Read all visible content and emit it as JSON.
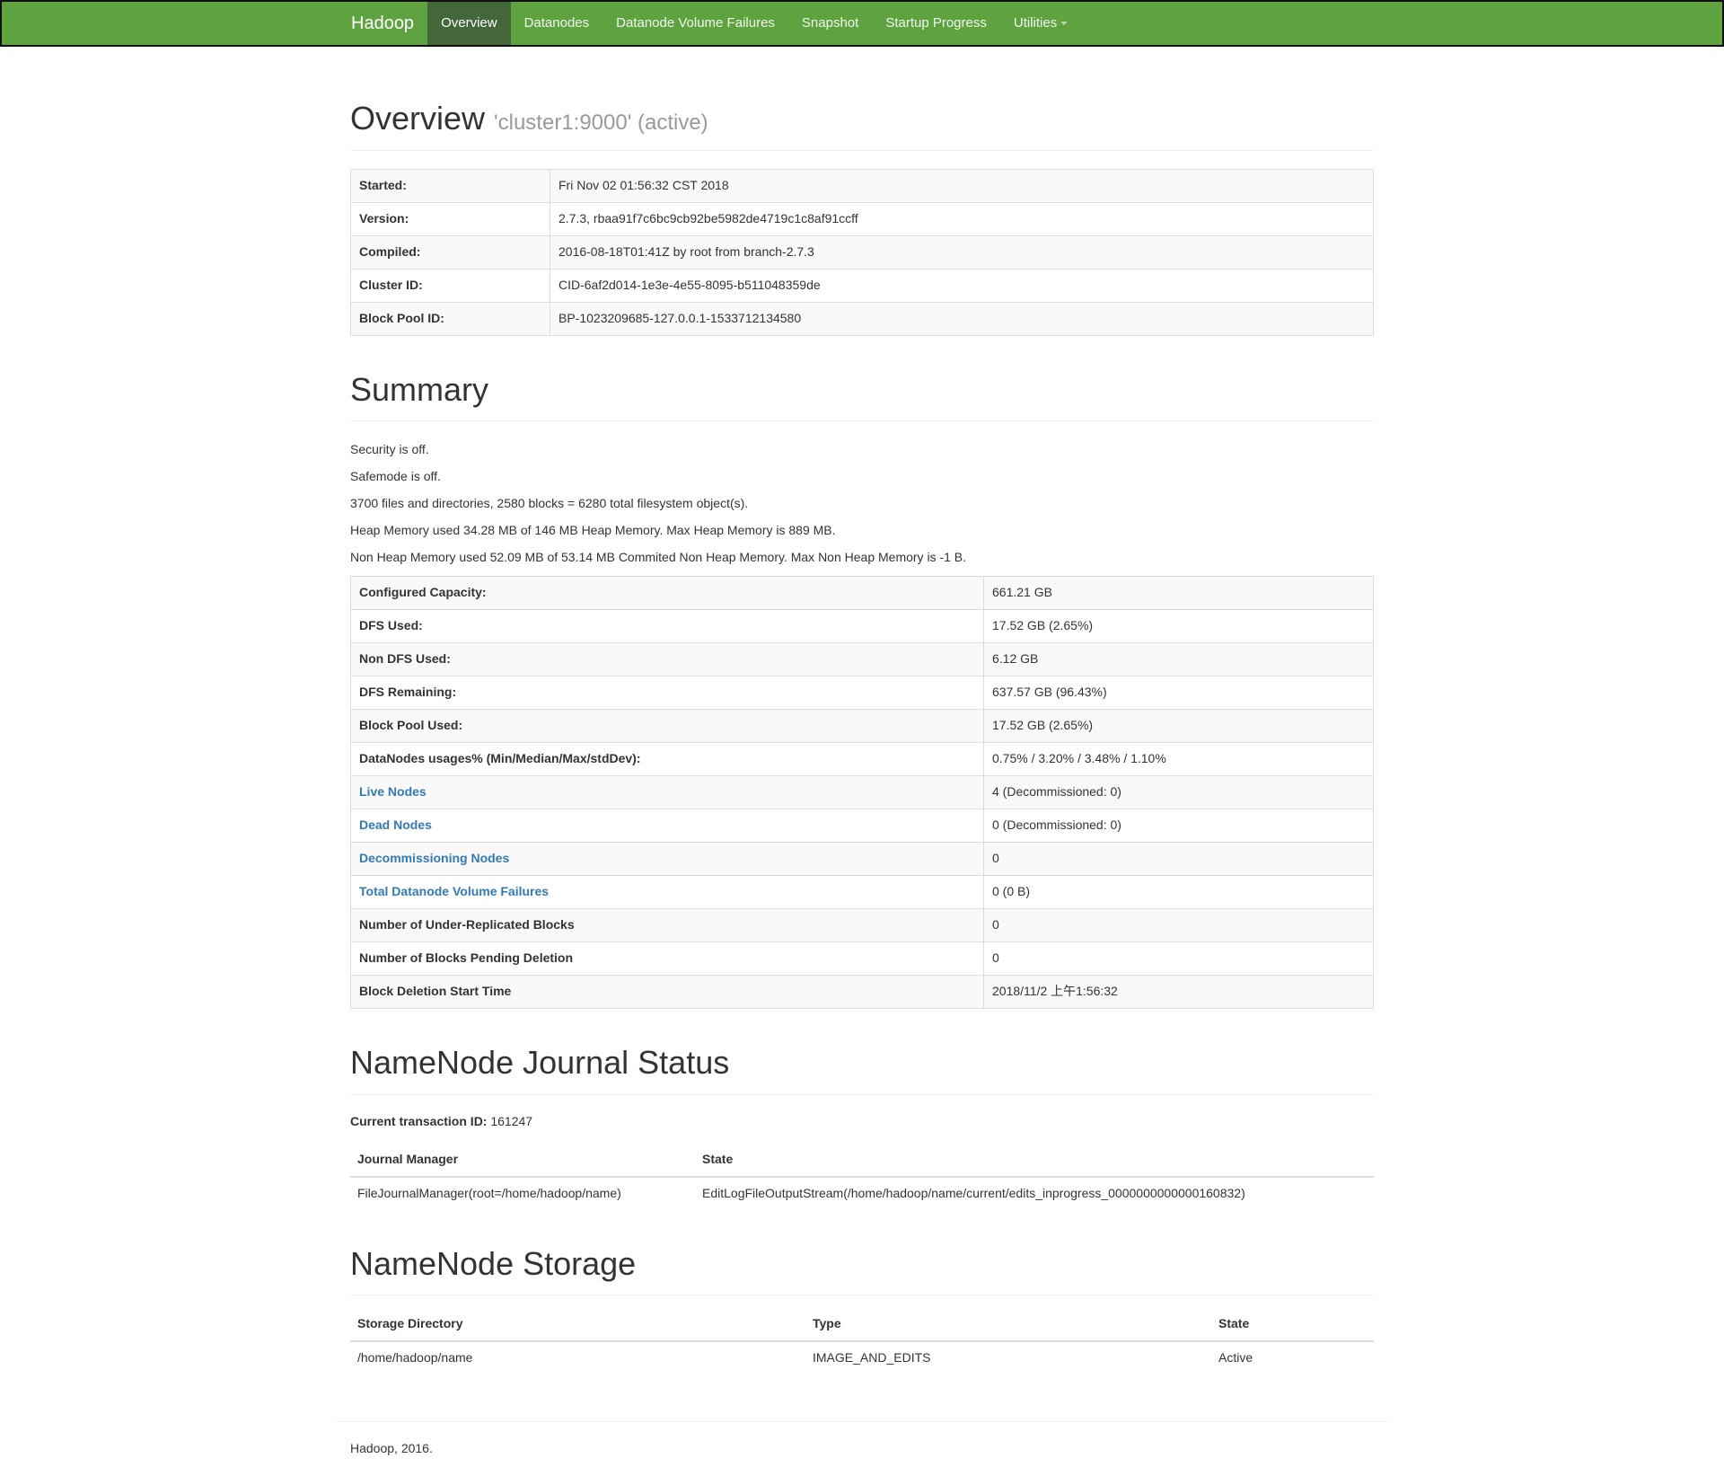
{
  "navbar": {
    "brand": "Hadoop",
    "items": [
      {
        "label": "Overview",
        "active": true
      },
      {
        "label": "Datanodes"
      },
      {
        "label": "Datanode Volume Failures"
      },
      {
        "label": "Snapshot"
      },
      {
        "label": "Startup Progress"
      },
      {
        "label": "Utilities"
      }
    ],
    "colors": {
      "bar": "#5fa341",
      "active": "#43673a"
    }
  },
  "overview": {
    "title": "Overview",
    "subtitle": "'cluster1:9000' (active)",
    "rows": [
      {
        "label": "Started:",
        "value": "Fri Nov 02 01:56:32 CST 2018"
      },
      {
        "label": "Version:",
        "value": "2.7.3, rbaa91f7c6bc9cb92be5982de4719c1c8af91ccff"
      },
      {
        "label": "Compiled:",
        "value": "2016-08-18T01:41Z by root from branch-2.7.3"
      },
      {
        "label": "Cluster ID:",
        "value": "CID-6af2d014-1e3e-4e55-8095-b511048359de"
      },
      {
        "label": "Block Pool ID:",
        "value": "BP-1023209685-127.0.0.1-1533712134580"
      }
    ]
  },
  "summary": {
    "title": "Summary",
    "lines": [
      "Security is off.",
      "Safemode is off.",
      "3700 files and directories, 2580 blocks = 6280 total filesystem object(s).",
      "Heap Memory used 34.28 MB of 146 MB Heap Memory. Max Heap Memory is 889 MB.",
      "Non Heap Memory used 52.09 MB of 53.14 MB Commited Non Heap Memory. Max Non Heap Memory is -1 B."
    ],
    "rows": [
      {
        "label": "Configured Capacity:",
        "value": "661.21 GB"
      },
      {
        "label": "DFS Used:",
        "value": "17.52 GB (2.65%)"
      },
      {
        "label": "Non DFS Used:",
        "value": "6.12 GB"
      },
      {
        "label": "DFS Remaining:",
        "value": "637.57 GB (96.43%)"
      },
      {
        "label": "Block Pool Used:",
        "value": "17.52 GB (2.65%)"
      },
      {
        "label": "DataNodes usages% (Min/Median/Max/stdDev):",
        "value": "0.75% / 3.20% / 3.48% / 1.10%"
      },
      {
        "label": "Live Nodes",
        "value": "4 (Decommissioned: 0)",
        "link": true
      },
      {
        "label": "Dead Nodes",
        "value": "0 (Decommissioned: 0)",
        "link": true
      },
      {
        "label": "Decommissioning Nodes",
        "value": "0",
        "link": true
      },
      {
        "label": "Total Datanode Volume Failures",
        "value": "0 (0 B)",
        "link": true
      },
      {
        "label": "Number of Under-Replicated Blocks",
        "value": "0"
      },
      {
        "label": "Number of Blocks Pending Deletion",
        "value": "0"
      },
      {
        "label": "Block Deletion Start Time",
        "value": "2018/11/2 上午1:56:32"
      }
    ]
  },
  "journal": {
    "title": "NameNode Journal Status",
    "txid_label": "Current transaction ID:",
    "txid_value": "161247",
    "headers": [
      "Journal Manager",
      "State"
    ],
    "rows": [
      [
        "FileJournalManager(root=/home/hadoop/name)",
        "EditLogFileOutputStream(/home/hadoop/name/current/edits_inprogress_0000000000000160832)"
      ]
    ]
  },
  "storage": {
    "title": "NameNode Storage",
    "headers": [
      "Storage Directory",
      "Type",
      "State"
    ],
    "rows": [
      [
        "/home/hadoop/name",
        "IMAGE_AND_EDITS",
        "Active"
      ]
    ]
  },
  "footer": {
    "text": "Hadoop, 2016."
  }
}
